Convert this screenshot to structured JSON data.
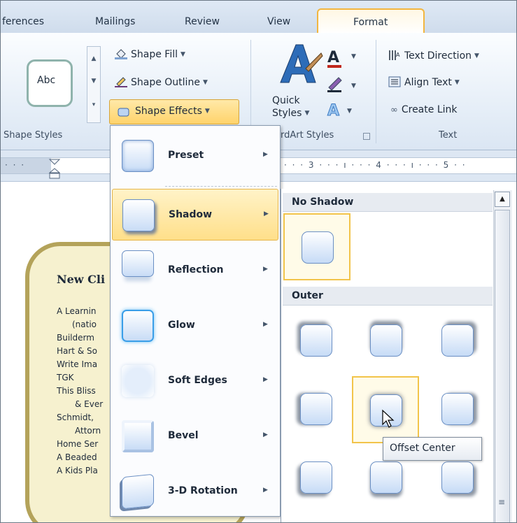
{
  "tabs": [
    "ferences",
    "Mailings",
    "Review",
    "View"
  ],
  "active_tab": "Format",
  "ribbon": {
    "shape_styles": {
      "sample_label": "Abc",
      "group_label": "Shape Styles"
    },
    "shape_fill": "Shape Fill",
    "shape_outline": "Shape Outline",
    "shape_effects": "Shape Effects",
    "quick_styles_line1": "Quick",
    "quick_styles_line2": "Styles",
    "wordart_group_label": "rdArt Styles",
    "text_direction": "Text Direction",
    "align_text": "Align Text",
    "create_link": "Create Link",
    "text_group_label": "Text"
  },
  "ruler": {
    "left_text": "· · ·",
    "right_text": "· · · 3 · · · ı · · · 4 · · · ı · · · 5 · ·"
  },
  "document": {
    "title": "New Cli",
    "lines": [
      "A Learnin",
      "(natio",
      "Builderm",
      "Hart & So",
      "Write Ima",
      "TGK",
      "This Bliss",
      "& Ever",
      "Schmidt,",
      "Attorn",
      "Home Ser",
      "A Beaded",
      "A Kids Pla"
    ]
  },
  "menu": {
    "items": [
      {
        "label": "Preset"
      },
      {
        "label": "Shadow"
      },
      {
        "label": "Reflection"
      },
      {
        "label": "Glow"
      },
      {
        "label": "Soft Edges"
      },
      {
        "label": "Bevel"
      },
      {
        "label": "3-D Rotation"
      }
    ],
    "highlighted": "Shadow"
  },
  "gallery": {
    "section_no_shadow": "No Shadow",
    "section_outer": "Outer",
    "selected": "Offset Center"
  },
  "tooltip": "Offset Center",
  "colors": {
    "accent_orange": "#f2b640",
    "menu_highlight": "#ffdf8a",
    "ribbon_blue": "#dbe6f3"
  }
}
